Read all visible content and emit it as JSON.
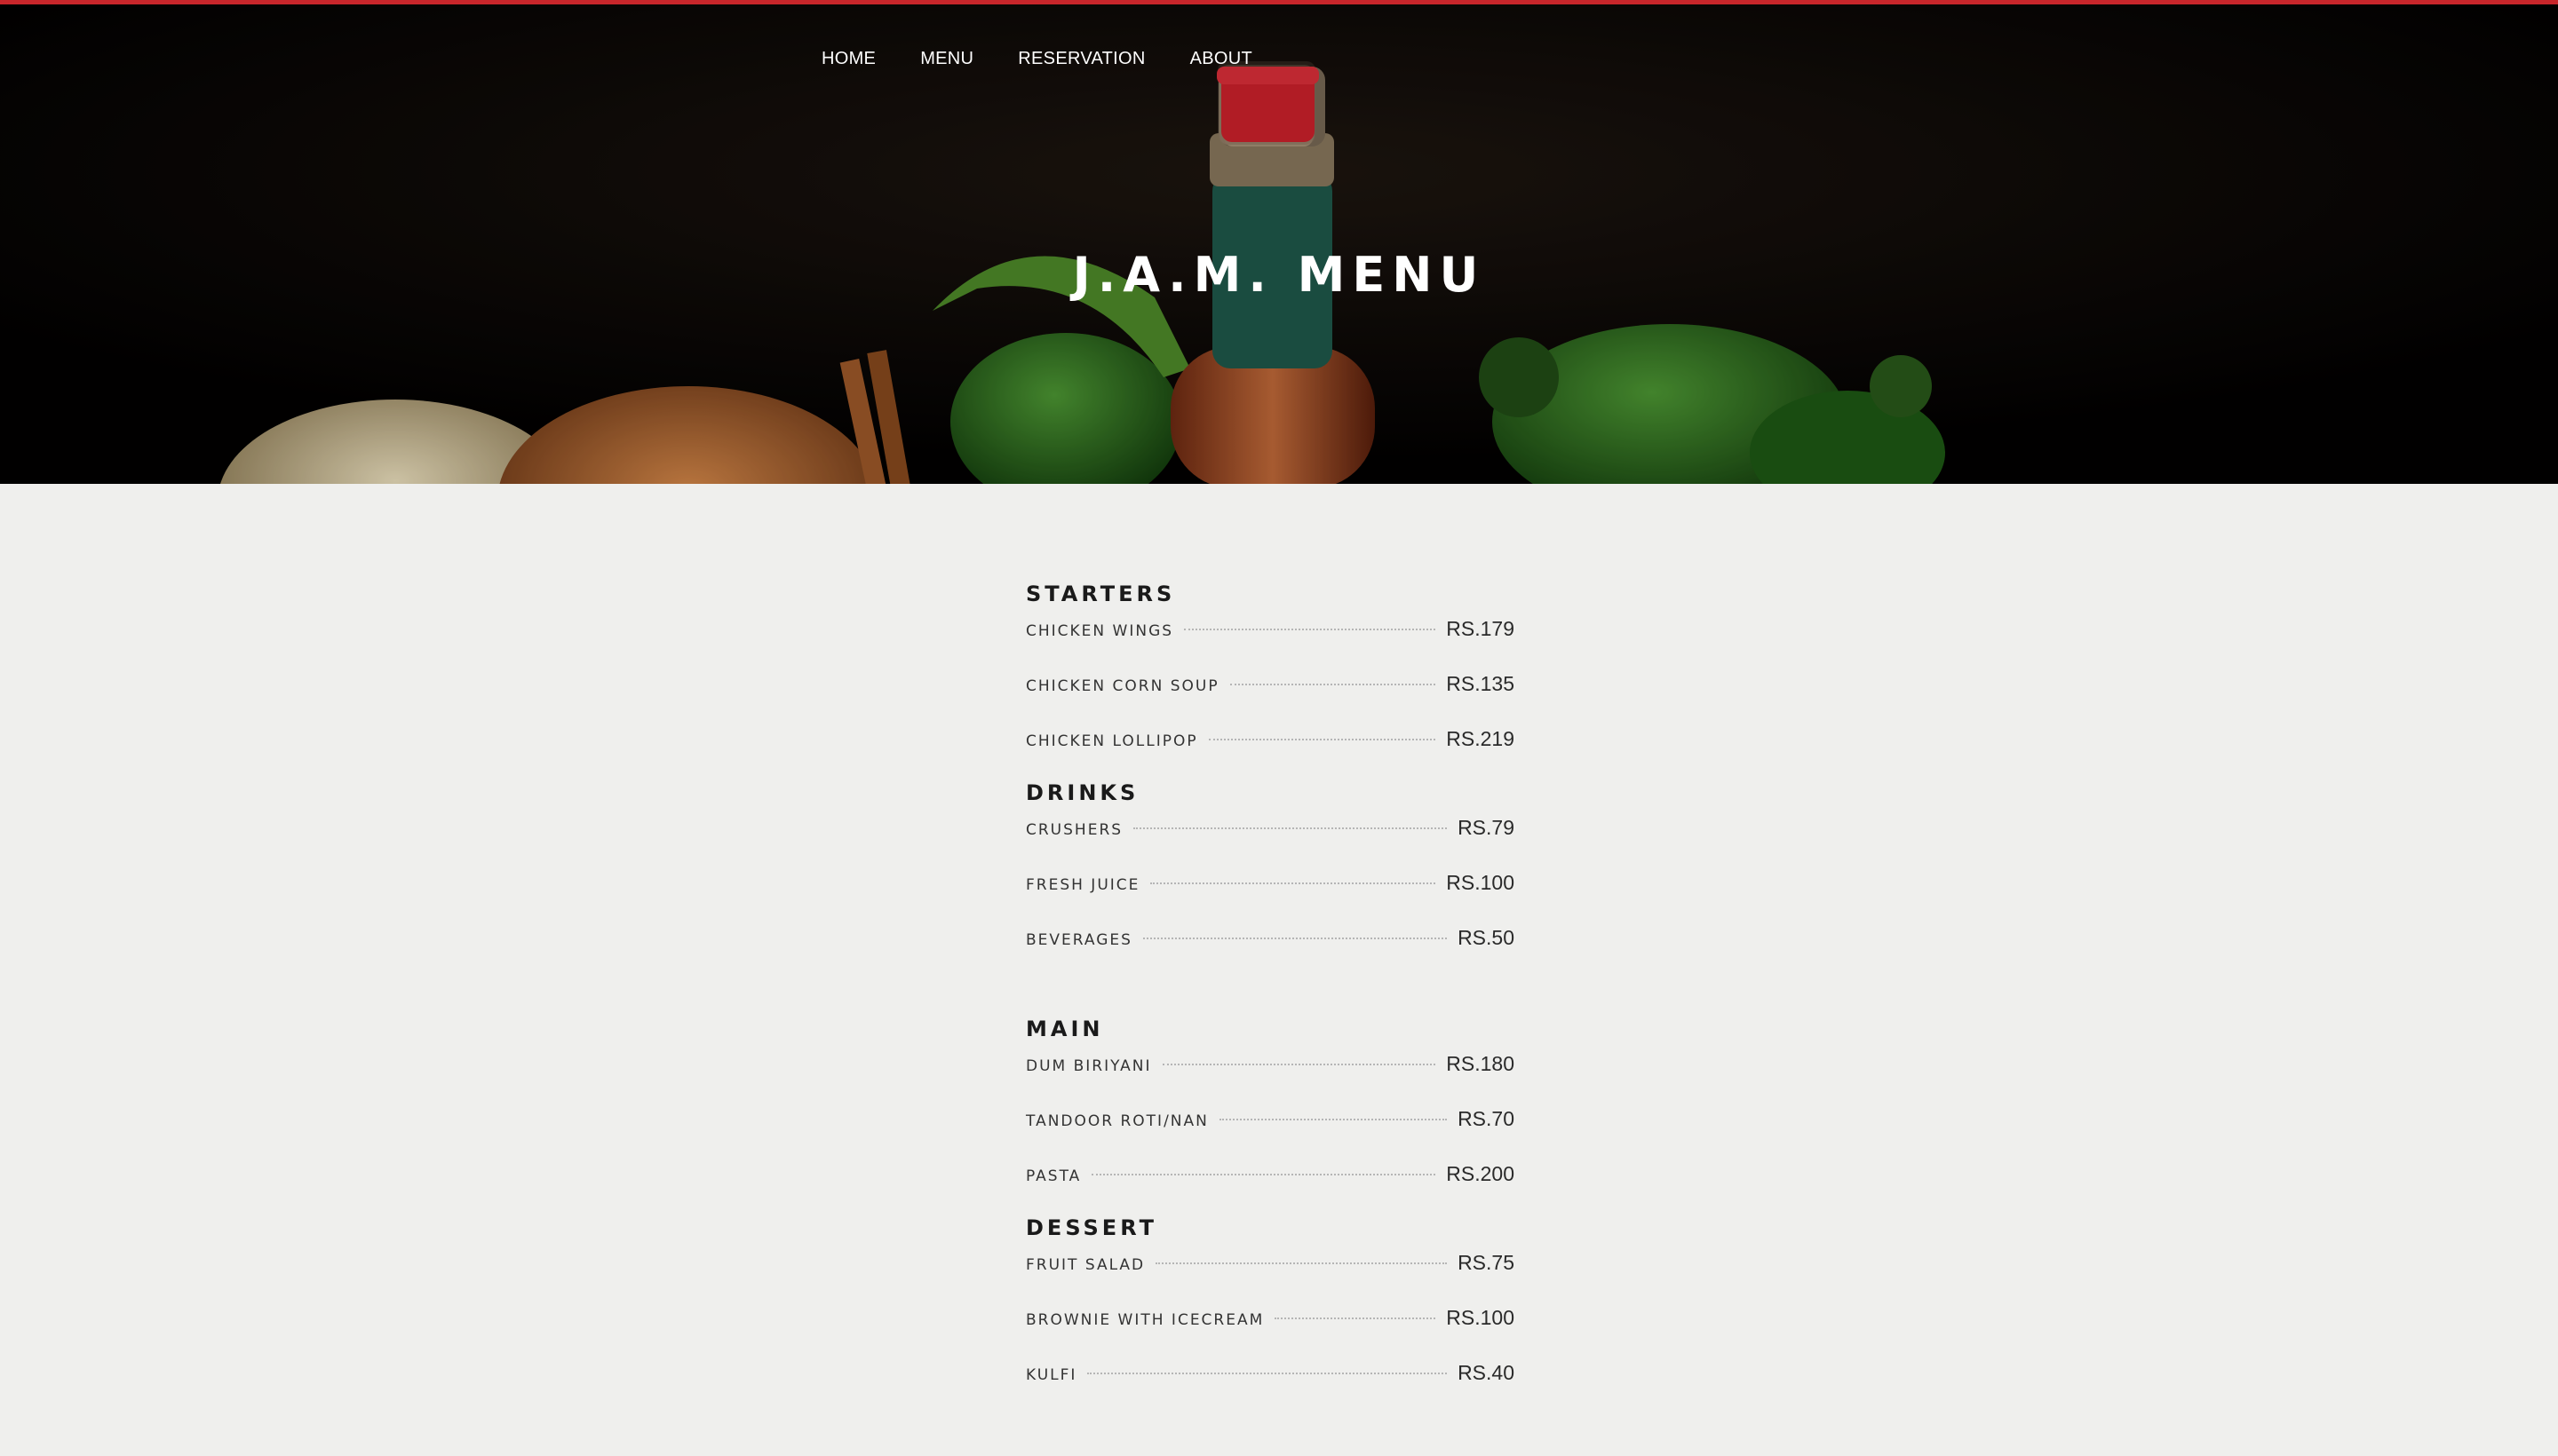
{
  "nav": {
    "items": [
      {
        "label": "HOME"
      },
      {
        "label": "MENU"
      },
      {
        "label": "RESERVATION"
      },
      {
        "label": "ABOUT"
      }
    ]
  },
  "hero": {
    "title": "J.A.M. MENU"
  },
  "menu": {
    "sections": [
      {
        "title": "STARTERS",
        "items": [
          {
            "name": "CHICKEN WINGS",
            "price": "RS.179"
          },
          {
            "name": "CHICKEN CORN SOUP",
            "price": "RS.135"
          },
          {
            "name": "CHICKEN LOLLIPOP",
            "price": "RS.219"
          }
        ]
      },
      {
        "title": "DRINKS",
        "items": [
          {
            "name": "CRUSHERS",
            "price": "RS.79"
          },
          {
            "name": "FRESH JUICE",
            "price": "RS.100"
          },
          {
            "name": "BEVERAGES",
            "price": "RS.50"
          }
        ]
      },
      {
        "title": "MAIN",
        "items": [
          {
            "name": "DUM BIRIYANI",
            "price": "RS.180"
          },
          {
            "name": "TANDOOR ROTI/NAN",
            "price": "RS.70"
          },
          {
            "name": "PASTA",
            "price": "RS.200"
          }
        ]
      },
      {
        "title": "DESSERT",
        "items": [
          {
            "name": "FRUIT SALAD",
            "price": "RS.75"
          },
          {
            "name": "BROWNIE WITH ICECREAM",
            "price": "RS.100"
          },
          {
            "name": "KULFI",
            "price": "RS.40"
          }
        ]
      }
    ]
  },
  "colors": {
    "accent": "#c8262b",
    "background": "#efefed",
    "hero": "#050302"
  }
}
